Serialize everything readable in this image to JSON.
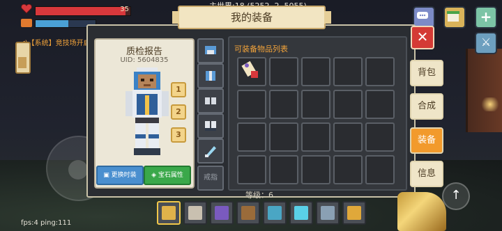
{
  "hud": {
    "hp_value": "35",
    "hp_fraction": 0.95,
    "hunger_fraction": 0.55,
    "coordinates": "主世界:18 (5252, 2, 5055)",
    "system_message": "◀)【系统】竞技场开启啦，点击右侧按钮报名参与，赢取积分奖励",
    "icons": [
      "heart-icon",
      "hunger-icon",
      "chat-icon",
      "shop-icon",
      "plus-icon",
      "sword-icon"
    ]
  },
  "panel": {
    "title": "我的装备",
    "close_symbol": "✕"
  },
  "report": {
    "title": "质检报告",
    "uid": "UID: 5604835",
    "numbers": [
      "1",
      "2",
      "3"
    ],
    "change_fashion": "更换时装",
    "gem_attr": "宝石属性"
  },
  "equipment_slots": [
    {
      "name": "helmet"
    },
    {
      "name": "armor"
    },
    {
      "name": "gloves"
    },
    {
      "name": "boots"
    },
    {
      "name": "weapon"
    },
    {
      "name": "ring",
      "label": "戒指"
    }
  ],
  "items": {
    "title": "可装备物品列表",
    "rows": 4,
    "cols": 5,
    "filled_index": 0
  },
  "side_tabs": [
    {
      "label": "背包",
      "active": false
    },
    {
      "label": "合成",
      "active": false
    },
    {
      "label": "装备",
      "active": true
    },
    {
      "label": "信息",
      "active": false
    }
  ],
  "bottom": {
    "level": "等级：6",
    "fps": "fps:4 ping:111",
    "hotbar": [
      {
        "icon": "wrench-icon",
        "color": "#e0b24a",
        "active": true
      },
      {
        "icon": "map-icon",
        "color": "#c9c0b0",
        "active": false
      },
      {
        "icon": "book-icon",
        "color": "#7a5abf",
        "active": false
      },
      {
        "icon": "block-icon",
        "color": "#9a6b3a",
        "active": false
      },
      {
        "icon": "pickaxe-icon",
        "color": "#4aa6c4",
        "active": false
      },
      {
        "icon": "diamond-block-icon",
        "color": "#5ad0e8",
        "active": false
      },
      {
        "icon": "drill-icon",
        "color": "#8aa0b4",
        "active": false
      },
      {
        "icon": "bucket-icon",
        "color": "#e0a83a",
        "active": false
      }
    ]
  }
}
